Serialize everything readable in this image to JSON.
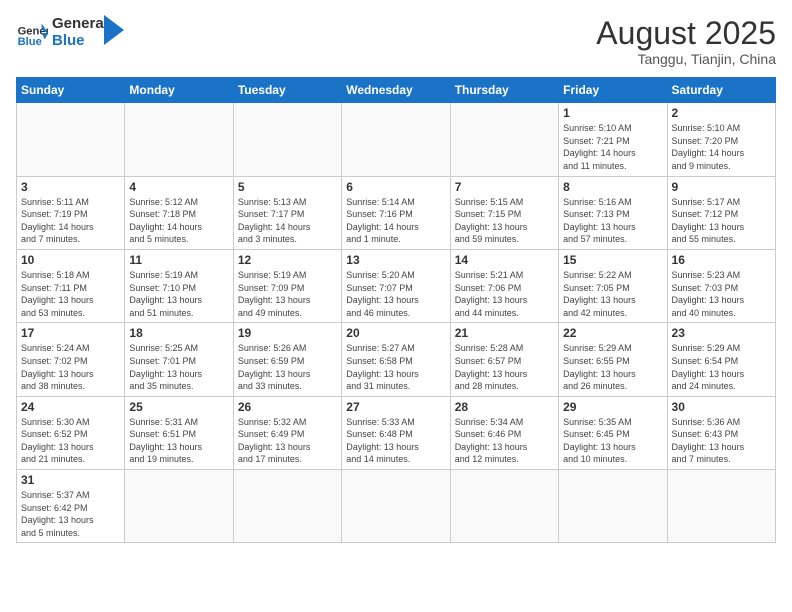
{
  "logo": {
    "text_general": "General",
    "text_blue": "Blue"
  },
  "title": "August 2025",
  "subtitle": "Tanggu, Tianjin, China",
  "weekdays": [
    "Sunday",
    "Monday",
    "Tuesday",
    "Wednesday",
    "Thursday",
    "Friday",
    "Saturday"
  ],
  "weeks": [
    [
      {
        "day": "",
        "info": ""
      },
      {
        "day": "",
        "info": ""
      },
      {
        "day": "",
        "info": ""
      },
      {
        "day": "",
        "info": ""
      },
      {
        "day": "",
        "info": ""
      },
      {
        "day": "1",
        "info": "Sunrise: 5:10 AM\nSunset: 7:21 PM\nDaylight: 14 hours\nand 11 minutes."
      },
      {
        "day": "2",
        "info": "Sunrise: 5:10 AM\nSunset: 7:20 PM\nDaylight: 14 hours\nand 9 minutes."
      }
    ],
    [
      {
        "day": "3",
        "info": "Sunrise: 5:11 AM\nSunset: 7:19 PM\nDaylight: 14 hours\nand 7 minutes."
      },
      {
        "day": "4",
        "info": "Sunrise: 5:12 AM\nSunset: 7:18 PM\nDaylight: 14 hours\nand 5 minutes."
      },
      {
        "day": "5",
        "info": "Sunrise: 5:13 AM\nSunset: 7:17 PM\nDaylight: 14 hours\nand 3 minutes."
      },
      {
        "day": "6",
        "info": "Sunrise: 5:14 AM\nSunset: 7:16 PM\nDaylight: 14 hours\nand 1 minute."
      },
      {
        "day": "7",
        "info": "Sunrise: 5:15 AM\nSunset: 7:15 PM\nDaylight: 13 hours\nand 59 minutes."
      },
      {
        "day": "8",
        "info": "Sunrise: 5:16 AM\nSunset: 7:13 PM\nDaylight: 13 hours\nand 57 minutes."
      },
      {
        "day": "9",
        "info": "Sunrise: 5:17 AM\nSunset: 7:12 PM\nDaylight: 13 hours\nand 55 minutes."
      }
    ],
    [
      {
        "day": "10",
        "info": "Sunrise: 5:18 AM\nSunset: 7:11 PM\nDaylight: 13 hours\nand 53 minutes."
      },
      {
        "day": "11",
        "info": "Sunrise: 5:19 AM\nSunset: 7:10 PM\nDaylight: 13 hours\nand 51 minutes."
      },
      {
        "day": "12",
        "info": "Sunrise: 5:19 AM\nSunset: 7:09 PM\nDaylight: 13 hours\nand 49 minutes."
      },
      {
        "day": "13",
        "info": "Sunrise: 5:20 AM\nSunset: 7:07 PM\nDaylight: 13 hours\nand 46 minutes."
      },
      {
        "day": "14",
        "info": "Sunrise: 5:21 AM\nSunset: 7:06 PM\nDaylight: 13 hours\nand 44 minutes."
      },
      {
        "day": "15",
        "info": "Sunrise: 5:22 AM\nSunset: 7:05 PM\nDaylight: 13 hours\nand 42 minutes."
      },
      {
        "day": "16",
        "info": "Sunrise: 5:23 AM\nSunset: 7:03 PM\nDaylight: 13 hours\nand 40 minutes."
      }
    ],
    [
      {
        "day": "17",
        "info": "Sunrise: 5:24 AM\nSunset: 7:02 PM\nDaylight: 13 hours\nand 38 minutes."
      },
      {
        "day": "18",
        "info": "Sunrise: 5:25 AM\nSunset: 7:01 PM\nDaylight: 13 hours\nand 35 minutes."
      },
      {
        "day": "19",
        "info": "Sunrise: 5:26 AM\nSunset: 6:59 PM\nDaylight: 13 hours\nand 33 minutes."
      },
      {
        "day": "20",
        "info": "Sunrise: 5:27 AM\nSunset: 6:58 PM\nDaylight: 13 hours\nand 31 minutes."
      },
      {
        "day": "21",
        "info": "Sunrise: 5:28 AM\nSunset: 6:57 PM\nDaylight: 13 hours\nand 28 minutes."
      },
      {
        "day": "22",
        "info": "Sunrise: 5:29 AM\nSunset: 6:55 PM\nDaylight: 13 hours\nand 26 minutes."
      },
      {
        "day": "23",
        "info": "Sunrise: 5:29 AM\nSunset: 6:54 PM\nDaylight: 13 hours\nand 24 minutes."
      }
    ],
    [
      {
        "day": "24",
        "info": "Sunrise: 5:30 AM\nSunset: 6:52 PM\nDaylight: 13 hours\nand 21 minutes."
      },
      {
        "day": "25",
        "info": "Sunrise: 5:31 AM\nSunset: 6:51 PM\nDaylight: 13 hours\nand 19 minutes."
      },
      {
        "day": "26",
        "info": "Sunrise: 5:32 AM\nSunset: 6:49 PM\nDaylight: 13 hours\nand 17 minutes."
      },
      {
        "day": "27",
        "info": "Sunrise: 5:33 AM\nSunset: 6:48 PM\nDaylight: 13 hours\nand 14 minutes."
      },
      {
        "day": "28",
        "info": "Sunrise: 5:34 AM\nSunset: 6:46 PM\nDaylight: 13 hours\nand 12 minutes."
      },
      {
        "day": "29",
        "info": "Sunrise: 5:35 AM\nSunset: 6:45 PM\nDaylight: 13 hours\nand 10 minutes."
      },
      {
        "day": "30",
        "info": "Sunrise: 5:36 AM\nSunset: 6:43 PM\nDaylight: 13 hours\nand 7 minutes."
      }
    ],
    [
      {
        "day": "31",
        "info": "Sunrise: 5:37 AM\nSunset: 6:42 PM\nDaylight: 13 hours\nand 5 minutes."
      },
      {
        "day": "",
        "info": ""
      },
      {
        "day": "",
        "info": ""
      },
      {
        "day": "",
        "info": ""
      },
      {
        "day": "",
        "info": ""
      },
      {
        "day": "",
        "info": ""
      },
      {
        "day": "",
        "info": ""
      }
    ]
  ]
}
